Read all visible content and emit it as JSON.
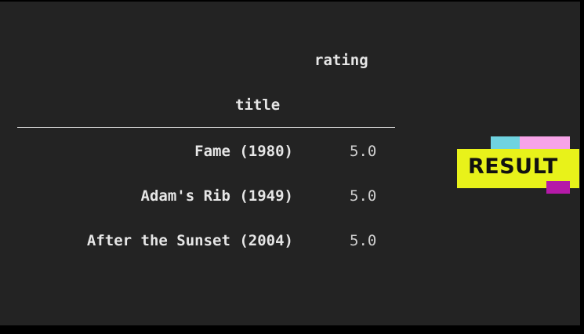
{
  "table": {
    "value_column_header": "rating",
    "index_header": "title",
    "rows": [
      {
        "title": "Fame (1980)",
        "rating": "5.0"
      },
      {
        "title": "Adam's Rib (1949)",
        "rating": "5.0"
      },
      {
        "title": "After the Sunset (2004)",
        "rating": "5.0"
      }
    ]
  },
  "badge": {
    "label": "RESULT",
    "colors": {
      "badge": "#e8f21a",
      "cyan": "#6fd3e0",
      "pink": "#f7a3e8",
      "magenta": "#b51aa8"
    }
  }
}
